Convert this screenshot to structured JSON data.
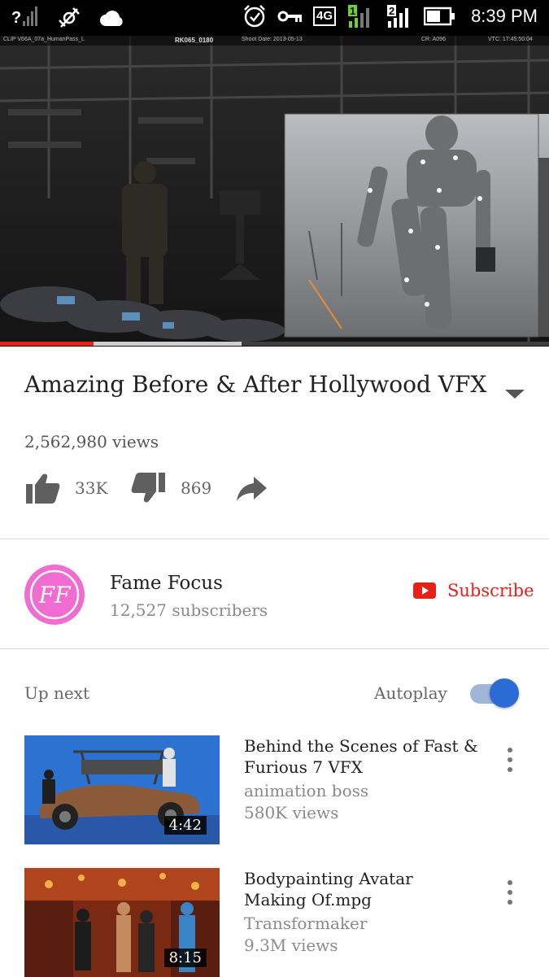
{
  "status_bar": {
    "time": "8:39 PM",
    "network": "4G",
    "sim1": "1",
    "sim2": "2"
  },
  "player": {
    "overlay": {
      "clip": "CLIP V66A_07a_HumanPass_L",
      "reel": "RK065_0180",
      "shoot_date": "Shoot Date: 2013-05-13",
      "cr": "CR: A096",
      "vtc": "VTC: 17:45:50:04"
    },
    "progress_fraction": 0.17,
    "buffer_fraction": 0.44
  },
  "video": {
    "title": "Amazing Before & After Hollywood VFX",
    "views": "2,562,980 views",
    "likes": "33K",
    "dislikes": "869"
  },
  "channel": {
    "name": "Fame Focus",
    "subscribers": "12,527 subscribers",
    "subscribe_label": "Subscribe",
    "avatar_text": "FF"
  },
  "up_next": {
    "label": "Up next",
    "autoplay_label": "Autoplay",
    "autoplay_on": true,
    "items": [
      {
        "title": "Behind the Scenes of Fast & Furious 7 VFX",
        "channel": "animation boss",
        "views": "580K views",
        "duration": "4:42"
      },
      {
        "title": "Bodypainting Avatar Making Of.mpg",
        "channel": "Transformaker",
        "views": "9.3M views",
        "duration": "8:15"
      }
    ]
  },
  "colors": {
    "accent_red": "#e62117",
    "toggle_blue": "#2c6bd6",
    "avatar_pink": "#f06cd0"
  },
  "icons": [
    "signal-icon",
    "satellite-icon",
    "cloud-icon",
    "alarm-icon",
    "key-icon",
    "battery-icon",
    "thumb-up-icon",
    "thumb-down-icon",
    "share-icon",
    "chevron-down-icon",
    "youtube-play-icon",
    "more-vert-icon"
  ]
}
